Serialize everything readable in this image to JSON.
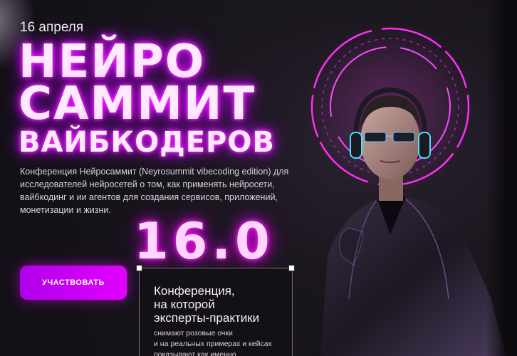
{
  "event": {
    "date": "16 апреля",
    "title_line1": "НЕЙРО",
    "title_line2": "САММИТ",
    "title_line3": "ВАЙБКОДЕРОВ",
    "description": "Конференция Нейросаммит (Neyrosummit vibecoding edition) для исследователей нейросетей о том, как применять нейросети, вайбкодинг и ии агентов для создания сервисов, приложений, монетизации и жизни.",
    "version": "16.0"
  },
  "cta": {
    "label": "УЧАСТВОВАТЬ"
  },
  "card": {
    "title": "Конференция,\nна которой\nэксперты-практики",
    "text": "снимают розовые очки\nи на реальных примерах и кейсах\nпоказывают как именно"
  },
  "colors": {
    "accent": "#e200ff",
    "neon_glow": "#ff4dff",
    "background": "#121015"
  },
  "hero": {
    "icon": "neon-man-with-headphones-illustration"
  }
}
